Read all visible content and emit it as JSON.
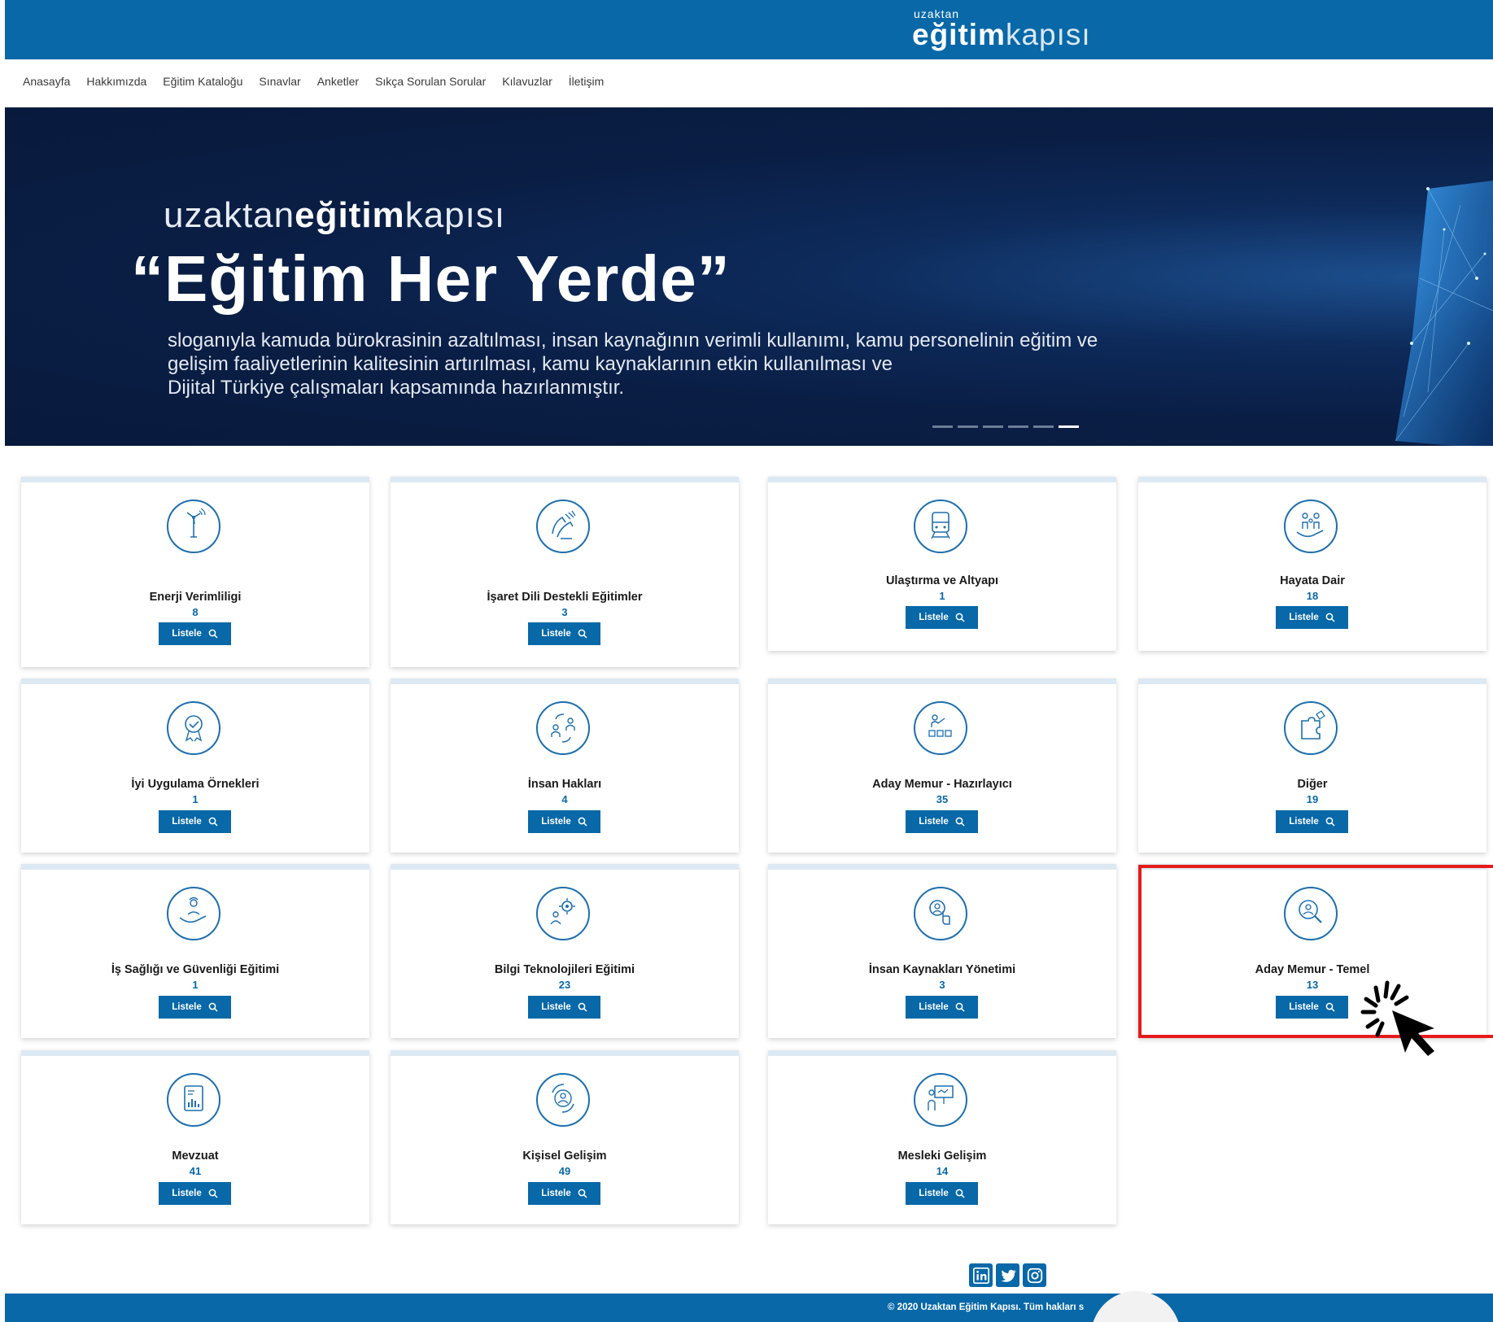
{
  "header": {
    "logo_small": "uzaktan",
    "logo_bold": "eğitim",
    "logo_light": "kapısı"
  },
  "nav": {
    "items": [
      "Anasayfa",
      "Hakkımızda",
      "Eğitim Kataloğu",
      "Sınavlar",
      "Anketler",
      "Sıkça Sorulan Sorular",
      "Kılavuzlar",
      "İletişim"
    ]
  },
  "banner": {
    "brand_light1": "uzaktan",
    "brand_bold": "eğitim",
    "brand_light2": "kapısı",
    "slogan": "“Eğitim Her Yerde”",
    "desc_lines": [
      "sloganıyla kamuda bürokrasinin azaltılması, insan kaynağının verimli kullanımı, kamu personelinin eğitim ve",
      "gelişim faaliyetlerinin kalitesinin artırılması, kamu kaynaklarının etkin kullanılması ve",
      "Dijital Türkiye çalışmaları kapsamında hazırlanmıştır."
    ],
    "slide_count": 6,
    "active_slide": 6
  },
  "button_label": "Listele",
  "categories": [
    {
      "title": "Enerji Verimliligi",
      "count": "8",
      "icon": "wind-turbine-icon"
    },
    {
      "title": "İşaret Dili Destekli Eğitimler",
      "count": "3",
      "icon": "sign-language-hands-icon"
    },
    {
      "title": "Ulaştırma ve Altyapı",
      "count": "1",
      "icon": "train-icon"
    },
    {
      "title": "Hayata Dair",
      "count": "18",
      "icon": "family-in-hand-icon"
    },
    {
      "title": "İyi Uygulama Örnekleri",
      "count": "1",
      "icon": "award-badge-icon"
    },
    {
      "title": "İnsan Hakları",
      "count": "4",
      "icon": "people-exchange-icon"
    },
    {
      "title": "Aday Memur - Hazırlayıcı",
      "count": "35",
      "icon": "presentation-checkboxes-icon"
    },
    {
      "title": "Diğer",
      "count": "19",
      "icon": "puzzle-icon"
    },
    {
      "title": "İş Sağlığı ve Güvenliği Eğitimi",
      "count": "1",
      "icon": "worker-in-hand-icon"
    },
    {
      "title": "Bilgi Teknolojileri Eğitimi",
      "count": "23",
      "icon": "gear-person-icon"
    },
    {
      "title": "İnsan Kaynakları Yönetimi",
      "count": "3",
      "icon": "hand-select-person-icon"
    },
    {
      "title": "Aday Memur - Temel",
      "count": "13",
      "icon": "magnifier-person-icon"
    },
    {
      "title": "Mevzuat",
      "count": "41",
      "icon": "document-chart-icon"
    },
    {
      "title": "Kişisel Gelişim",
      "count": "49",
      "icon": "person-cycle-icon"
    },
    {
      "title": "Mesleki Gelişim",
      "count": "14",
      "icon": "presenter-board-icon"
    }
  ],
  "footer": {
    "copyright": "© 2020 Uzaktan Eğitim Kapısı. Tüm hakları s",
    "social": [
      "linkedin-icon",
      "twitter-icon",
      "instagram-icon"
    ]
  },
  "colors": {
    "brand_blue": "#0868a8",
    "highlight_red": "#e51b1b"
  }
}
